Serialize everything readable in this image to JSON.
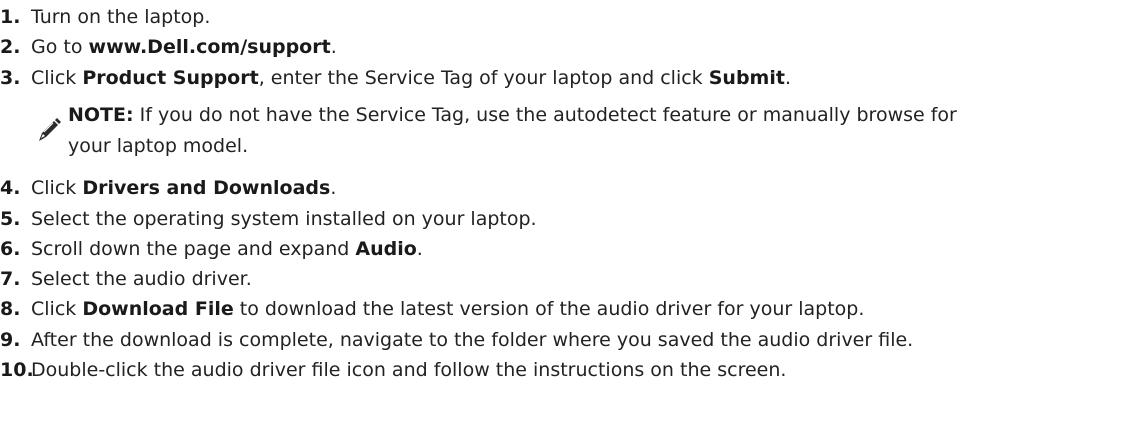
{
  "steps": [
    {
      "num": "1.",
      "parts": [
        {
          "t": "Turn on the laptop.",
          "b": false
        }
      ]
    },
    {
      "num": "2.",
      "parts": [
        {
          "t": "Go to ",
          "b": false
        },
        {
          "t": "www.Dell.com/support",
          "b": true
        },
        {
          "t": ".",
          "b": false
        }
      ]
    },
    {
      "num": "3.",
      "parts": [
        {
          "t": "Click ",
          "b": false
        },
        {
          "t": "Product Support",
          "b": true
        },
        {
          "t": ", enter the Service Tag of your laptop and click ",
          "b": false
        },
        {
          "t": "Submit",
          "b": true
        },
        {
          "t": ".",
          "b": false
        }
      ]
    },
    {
      "num": "4.",
      "parts": [
        {
          "t": "Click ",
          "b": false
        },
        {
          "t": "Drivers and Downloads",
          "b": true
        },
        {
          "t": ".",
          "b": false
        }
      ]
    },
    {
      "num": "5.",
      "parts": [
        {
          "t": "Select the operating system installed on your laptop.",
          "b": false
        }
      ]
    },
    {
      "num": "6.",
      "parts": [
        {
          "t": "Scroll down the page and expand ",
          "b": false
        },
        {
          "t": "Audio",
          "b": true
        },
        {
          "t": ".",
          "b": false
        }
      ]
    },
    {
      "num": "7.",
      "parts": [
        {
          "t": "Select the audio driver.",
          "b": false
        }
      ]
    },
    {
      "num": "8.",
      "parts": [
        {
          "t": "Click ",
          "b": false
        },
        {
          "t": "Download File",
          "b": true
        },
        {
          "t": " to download the latest version of the audio driver for your laptop.",
          "b": false
        }
      ]
    },
    {
      "num": "9.",
      "parts": [
        {
          "t": "After the download is complete, navigate to the folder where you saved the audio driver file.",
          "b": false
        }
      ]
    },
    {
      "num": "10.",
      "parts": [
        {
          "t": "Double-click the audio driver file icon and follow the instructions on the screen.",
          "b": false
        }
      ]
    }
  ],
  "note": {
    "icon": "note-pencil-icon",
    "label": "NOTE:",
    "line1": " If you do not have the Service Tag, use the autodetect feature or manually browse for",
    "line2": "your laptop model."
  }
}
